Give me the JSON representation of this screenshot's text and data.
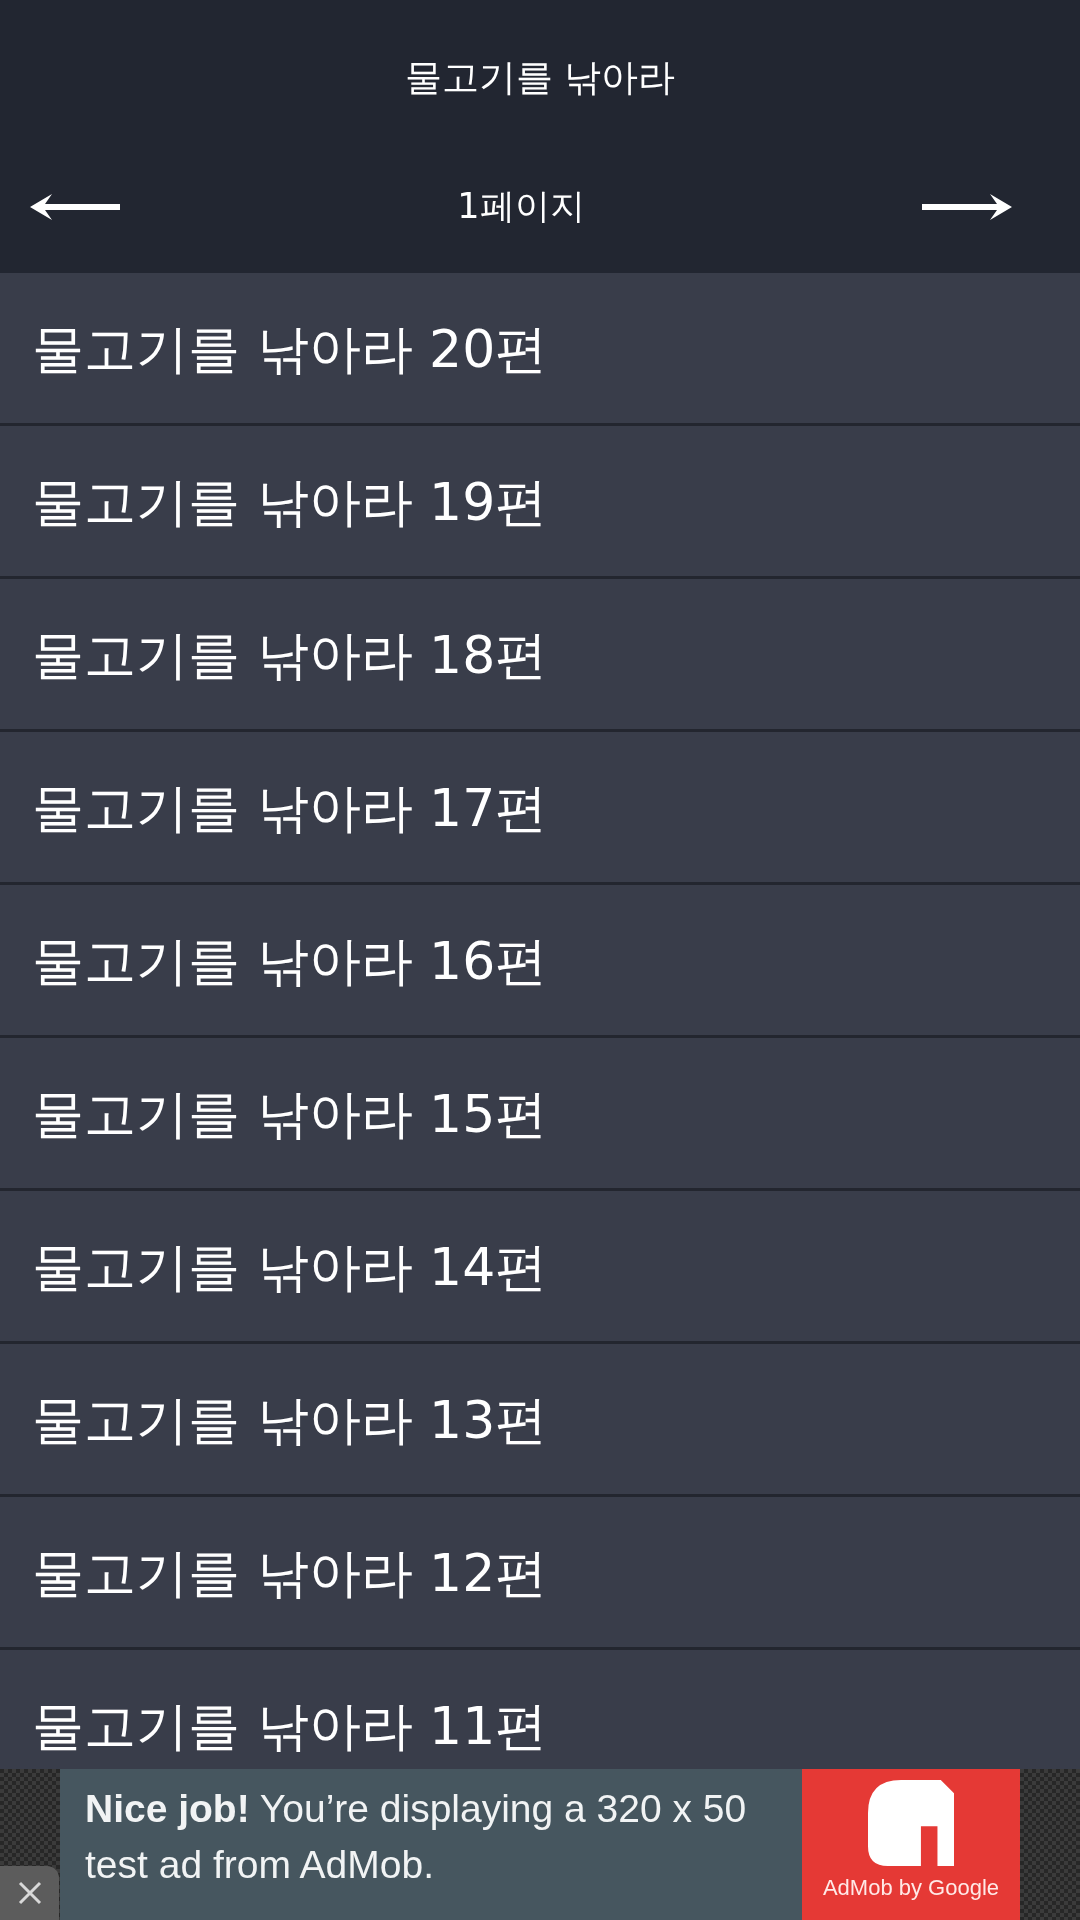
{
  "header": {
    "title": "물고기를 낚아라",
    "page_label": "1페이지"
  },
  "episodes": [
    "물고기를 낚아라 20편",
    "물고기를 낚아라 19편",
    "물고기를 낚아라 18편",
    "물고기를 낚아라 17편",
    "물고기를 낚아라 16편",
    "물고기를 낚아라 15편",
    "물고기를 낚아라 14편",
    "물고기를 낚아라 13편",
    "물고기를 낚아라 12편",
    "물고기를 낚아라 11편"
  ],
  "ad": {
    "text": "**Nice job!** You’re displaying a 320 x 50 test ad from AdMob.",
    "brand": "AdMob by Google"
  }
}
